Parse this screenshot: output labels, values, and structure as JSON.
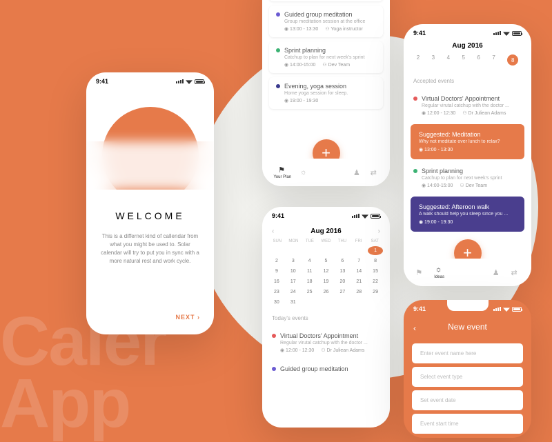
{
  "bg_text": "Caler\nApp",
  "status_time": "9:41",
  "accent": "#e67a4a",
  "welcome": {
    "title": "WELCOME",
    "body": "This is a differnet kind of callendar from what you might be used to. Solar calendar will try to put you in sync with a more natural rest and work cycle.",
    "next": "NEXT ›"
  },
  "events_list": [
    {
      "color": "#e55a5a",
      "title": "Virtual Doctors' Appointment",
      "sub": "Regular virutal catchup with the doctor...",
      "time": "12:00 - 12:30",
      "who": "Dr Juliean Adams"
    },
    {
      "color": "#6b5bd2",
      "title": "Guided group meditation",
      "sub": "Group meditation session at the office",
      "time": "13:00 - 13:30",
      "who": "Yoga instructor"
    },
    {
      "color": "#3bb273",
      "title": "Sprint planning",
      "sub": "Catchup to plan for next week's sprint",
      "time": "14:00-15:00",
      "who": "Dev Team"
    },
    {
      "color": "#3a3a8e",
      "title": "Evening, yoga session",
      "sub": "Home yoga session for sleep.",
      "time": "19:00 - 19:30",
      "who": ""
    }
  ],
  "tabs": [
    {
      "label": "Your Plan",
      "icon": "⚑"
    },
    {
      "label": "",
      "icon": "☼"
    },
    {
      "label": "",
      "icon": ""
    },
    {
      "label": "",
      "icon": "♟"
    },
    {
      "label": "",
      "icon": "⇄"
    }
  ],
  "calendar": {
    "month": "Aug 2016",
    "day_labels": [
      "SUN",
      "MON",
      "TUE",
      "WED",
      "THU",
      "FRI",
      "SAT"
    ],
    "grid": [
      "",
      "",
      "",
      "",
      "",
      "",
      1,
      2,
      3,
      4,
      5,
      6,
      7,
      8,
      9,
      10,
      11,
      12,
      13,
      14,
      15,
      16,
      17,
      18,
      19,
      20,
      21,
      22,
      23,
      24,
      25,
      26,
      27,
      28,
      29,
      30,
      31,
      "",
      "",
      "",
      "",
      ""
    ],
    "selected": 1,
    "today_label": "Today's events",
    "today_events": [
      {
        "color": "#e55a5a",
        "title": "Virtual Doctors' Appointment",
        "sub": "Regular virutal catchup with the doctor ...",
        "time": "12:00 - 12:30",
        "who": "Dr Juliean Adams"
      },
      {
        "color": "#6b5bd2",
        "title": "Guided group meditation",
        "sub": "",
        "time": "",
        "who": ""
      }
    ]
  },
  "week_view": {
    "month": "Aug 2016",
    "days": [
      "2",
      "3",
      "4",
      "5",
      "6",
      "7",
      "8"
    ],
    "selected": "8",
    "accepted_label": "Accepted events",
    "items": [
      {
        "type": "plain",
        "color": "#e55a5a",
        "title": "Virtual Doctors' Appointment",
        "sub": "Regular virutal catchup with the doctor ...",
        "time": "12:00 - 12:30",
        "who": "Dr Juliean Adams"
      },
      {
        "type": "sugg",
        "style": "orange",
        "title": "Suggested: Meditation",
        "sub": "Why not meditate over lunch to relax?",
        "time": "13:00 - 13:30"
      },
      {
        "type": "plain",
        "color": "#3bb273",
        "title": "Sprint planning",
        "sub": "Catchup to plan for next week's sprint",
        "time": "14:00-15:00",
        "who": "Dev Team"
      },
      {
        "type": "sugg",
        "style": "blue",
        "title": "Suggested: Afteroon walk",
        "sub": "A walk should help you sleep since you ...",
        "time": "19:00 - 19:30"
      }
    ],
    "tabs_label": "Ideas"
  },
  "new_event": {
    "title": "New event",
    "fields": [
      "Enter event name here",
      "Select event type",
      "Set event date",
      "Event start time"
    ]
  }
}
